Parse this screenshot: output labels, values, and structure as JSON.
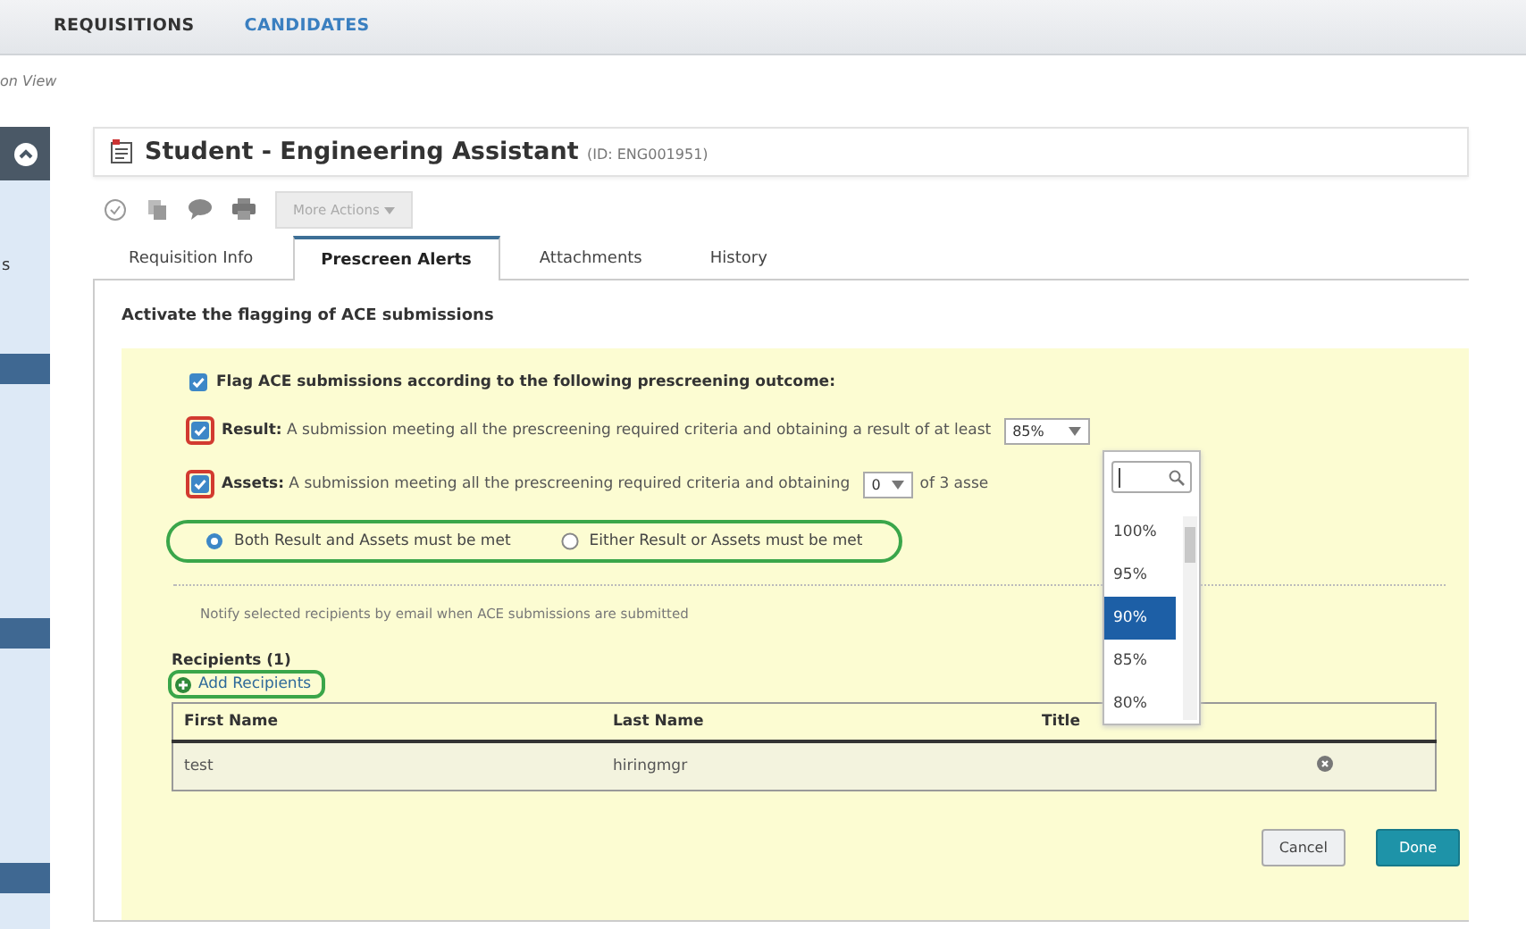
{
  "nav": {
    "tabs": [
      {
        "label": "REQUISITIONS",
        "selected": false
      },
      {
        "label": "CANDIDATES",
        "selected": true
      }
    ]
  },
  "breadcrumb": "on View",
  "sidebar": {
    "label": "s"
  },
  "requisition": {
    "title": "Student - Engineering Assistant",
    "id": "(ID: ENG001951)"
  },
  "toolbar": {
    "more_actions": {
      "label": "More Actions",
      "disabled": true
    }
  },
  "tabs": [
    {
      "label": "Requisition Info",
      "selected": false
    },
    {
      "label": "Prescreen Alerts",
      "selected": true
    },
    {
      "label": "Attachments",
      "selected": false
    },
    {
      "label": "History",
      "selected": false
    }
  ],
  "section_title": "Activate the flagging of ACE submissions",
  "flag": {
    "label": "Flag ACE submissions according to the following prescreening outcome:",
    "checked": true
  },
  "criteria": [
    {
      "text": "**Result:** A submission meeting all the prescreening required criteria and obtaining a result of at least",
      "checked": true,
      "highlighted": true,
      "select_value": "85%"
    },
    {
      "text": "**Assets:** A submission meeting all the prescreening required criteria and obtaining",
      "checked": true,
      "highlighted": true,
      "select_value": "0",
      "suffix": "of 3 asse"
    }
  ],
  "match_options": {
    "highlighted": true,
    "options": [
      {
        "label": "Both Result and Assets must be met",
        "selected": true
      },
      {
        "label": "Either Result or Assets must be met",
        "selected": false
      }
    ]
  },
  "notify_text": "Notify selected recipients by email when ACE submissions are submitted",
  "recipients": {
    "heading": "Recipients (1)",
    "add_label": "Add Recipients",
    "add_highlighted": true,
    "columns": [
      "First Name",
      "Last Name",
      "Title"
    ],
    "rows": [
      {
        "first_name": "test",
        "last_name": "hiringmgr"
      }
    ]
  },
  "dropdown": {
    "options": [
      {
        "label": "100%",
        "selected": false
      },
      {
        "label": "95%",
        "selected": false
      },
      {
        "label": "90%",
        "selected": true
      },
      {
        "label": "85%",
        "selected": false
      },
      {
        "label": "80%",
        "selected": false
      }
    ]
  },
  "buttons": [
    {
      "label": "Cancel",
      "kind": "secondary"
    },
    {
      "label": "Done",
      "kind": "primary"
    }
  ]
}
